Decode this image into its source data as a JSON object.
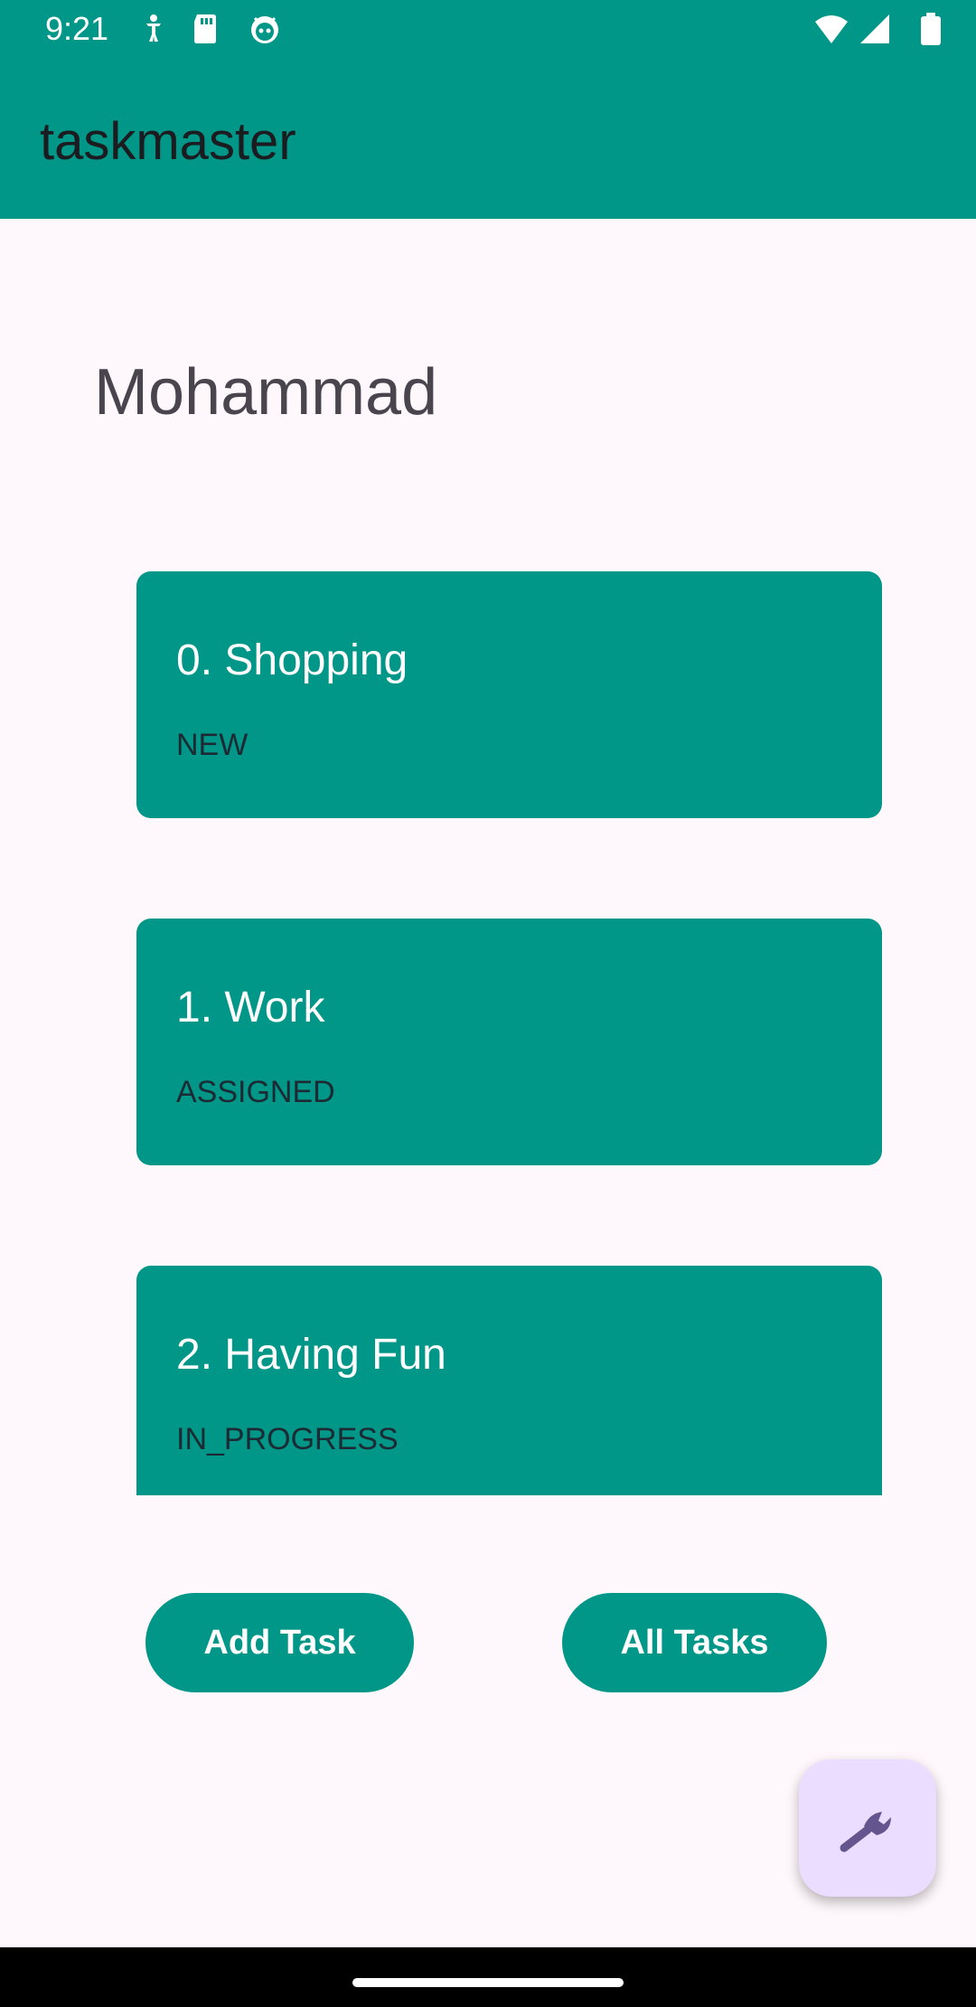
{
  "status_bar": {
    "time": "9:21",
    "left_icons": [
      "accessibility-icon",
      "sd-card-icon",
      "robot-face-icon"
    ],
    "right_icons": [
      "wifi-icon",
      "cell-signal-icon",
      "battery-icon"
    ]
  },
  "app_bar": {
    "title": "taskmaster"
  },
  "main": {
    "username": "Mohammad",
    "tasks": [
      {
        "title": "0. Shopping",
        "state": "NEW"
      },
      {
        "title": "1. Work",
        "state": "ASSIGNED"
      },
      {
        "title": "2. Having Fun",
        "state": "IN_PROGRESS"
      }
    ],
    "add_task_label": "Add Task",
    "all_tasks_label": "All Tasks"
  },
  "fab": {
    "icon": "wrench-icon"
  },
  "colors": {
    "primary": "#009688",
    "background": "#FEF7FB",
    "fab_background": "#EADDFF",
    "fab_icon": "#65558F"
  }
}
